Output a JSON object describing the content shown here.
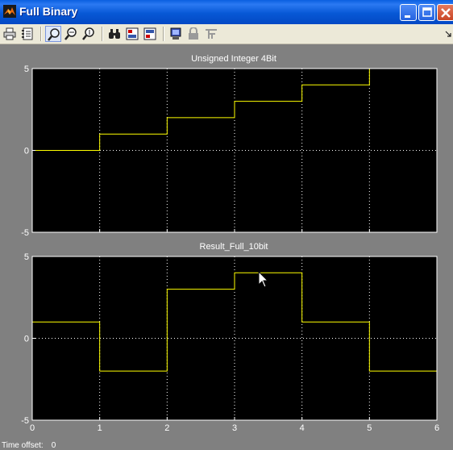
{
  "window": {
    "title": "Full Binary",
    "icon": "matlab-icon",
    "controls": [
      "minimize",
      "maximize",
      "close"
    ]
  },
  "toolbar": {
    "buttons": [
      {
        "name": "print",
        "icon": "printer-icon"
      },
      {
        "name": "parameters",
        "icon": "parameters-icon"
      },
      {
        "name": "zoom",
        "icon": "zoom-icon",
        "pressed": true
      },
      {
        "name": "zoom-x",
        "icon": "zoom-x-icon"
      },
      {
        "name": "zoom-y",
        "icon": "zoom-y-icon"
      },
      {
        "name": "autoscale",
        "icon": "binoculars-icon"
      },
      {
        "name": "save-axes",
        "icon": "save-axes-settings-icon"
      },
      {
        "name": "restore-axes",
        "icon": "restore-axes-icon"
      },
      {
        "name": "floating-scope",
        "icon": "floating-scope-icon"
      },
      {
        "name": "lock-axes",
        "icon": "lock-icon"
      },
      {
        "name": "signal-selection",
        "icon": "signal-selection-icon"
      }
    ]
  },
  "status": {
    "label": "Time offset:",
    "value": "0"
  },
  "colors": {
    "figure_bg": "#808080",
    "axes_bg": "#000000",
    "trace": "#ffff00",
    "grid": "#ffffff",
    "titlebar": "#0758d6"
  },
  "chart_data": [
    {
      "type": "line",
      "step": true,
      "title": "Unsigned Integer 4Bit",
      "xlim": [
        0,
        6
      ],
      "ylim": [
        -5,
        5
      ],
      "xticks": [
        0,
        1,
        2,
        3,
        4,
        5,
        6
      ],
      "yticks": [
        -5,
        0,
        5
      ],
      "ytick_labels": [
        "-5",
        "0",
        "5"
      ],
      "xtick_labels": [],
      "grid": true,
      "x": [
        0,
        1,
        2,
        3,
        4,
        5,
        6
      ],
      "y": [
        0,
        1,
        2,
        3,
        4,
        5,
        5
      ]
    },
    {
      "type": "line",
      "step": true,
      "title": "Result_Full_10bit",
      "xlim": [
        0,
        6
      ],
      "ylim": [
        -5,
        5
      ],
      "xticks": [
        0,
        1,
        2,
        3,
        4,
        5,
        6
      ],
      "yticks": [
        -5,
        0,
        5
      ],
      "ytick_labels": [
        "-5",
        "0",
        "5"
      ],
      "xtick_labels": [
        "0",
        "1",
        "2",
        "3",
        "4",
        "5",
        "6"
      ],
      "grid": true,
      "x": [
        0,
        1,
        2,
        3,
        4,
        5,
        6
      ],
      "y": [
        1,
        -2,
        3,
        4,
        1,
        -2,
        -2
      ]
    }
  ]
}
